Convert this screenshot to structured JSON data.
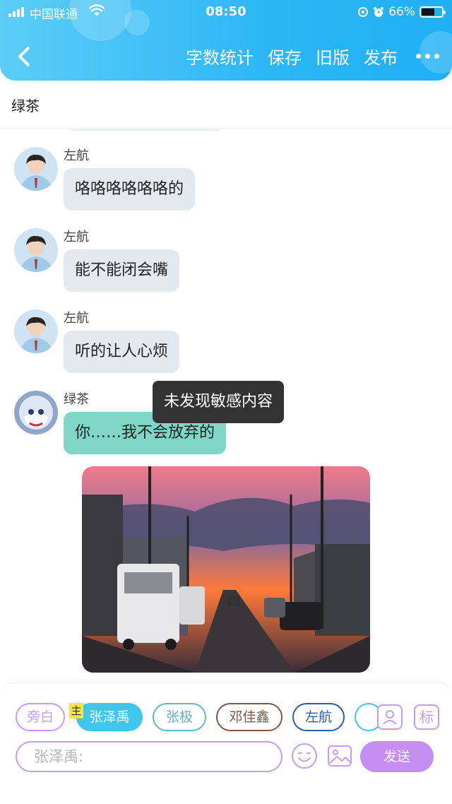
{
  "status_bar": {
    "carrier": "中国联通",
    "time": "08:50",
    "battery_percent": "66%",
    "battery_level": 0.66
  },
  "header": {
    "back_icon": "chevron-left-icon",
    "actions": [
      "字数统计",
      "保存",
      "旧版",
      "发布"
    ],
    "more_icon": "more-dots-icon",
    "accent_color": "#2cb6f6"
  },
  "chat": {
    "title": "绿茶",
    "messages": [
      {
        "sender": "左航",
        "text": "咯咯咯咯咯咯的"
      },
      {
        "sender": "左航",
        "text": "能不能闭会嘴"
      },
      {
        "sender": "左航",
        "text": "听的让人心烦"
      },
      {
        "sender": "绿茶",
        "text": "你……我不会放弃的"
      }
    ],
    "tooltip": "未发现敏感内容",
    "bubble_colors": {
      "others": "#e3e9ef",
      "self": "#7fd6c6"
    }
  },
  "composer": {
    "roles": [
      {
        "name": "旁白",
        "color": "#c79cf0",
        "active": false
      },
      {
        "name": "张泽禹",
        "color": "#3ec6ec",
        "active": true
      },
      {
        "name": "张极",
        "color": "#5fb7c8",
        "active": false
      },
      {
        "name": "邓佳鑫",
        "color": "#7a5a4a",
        "active": false
      },
      {
        "name": "左航",
        "color": "#2b5ea8",
        "active": false
      }
    ],
    "host_badge": "主",
    "role_manage_icon": "role-manage-icon",
    "tag_button": "标",
    "input_placeholder": "张泽禹:",
    "emoji_icon": "emoji-icon",
    "image_icon": "image-icon",
    "send_label": "发送",
    "accent_color": "#c79cf0"
  }
}
